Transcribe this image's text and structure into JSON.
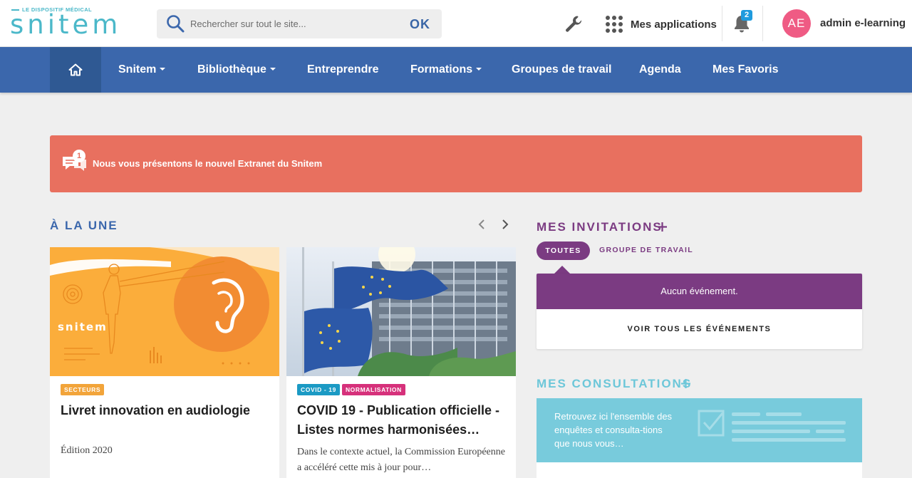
{
  "header": {
    "logo_tagline": "LE DISPOSITIF MÉDICAL",
    "logo_word": "snitem",
    "search_placeholder": "Rechercher sur tout le site...",
    "search_button": "OK",
    "apps_label": "Mes applications",
    "notifications_count": "2",
    "user_initials": "AE",
    "user_name": "admin e-learning"
  },
  "nav": {
    "items": [
      {
        "label": "Snitem",
        "dropdown": true
      },
      {
        "label": "Bibliothèque",
        "dropdown": true
      },
      {
        "label": "Entreprendre",
        "dropdown": false
      },
      {
        "label": "Formations",
        "dropdown": true
      },
      {
        "label": "Groupes de travail",
        "dropdown": false
      },
      {
        "label": "Agenda",
        "dropdown": false
      },
      {
        "label": "Mes Favoris",
        "dropdown": false
      }
    ]
  },
  "alert": {
    "count": "1",
    "text": "Nous vous présentons le nouvel Extranet du Snitem"
  },
  "une": {
    "title": "À LA UNE",
    "cards": [
      {
        "tags": [
          {
            "label": "SECTEURS",
            "color": "#f2a43a"
          }
        ],
        "image_label": "snitem",
        "title": "Livret innovation en audiologie",
        "meta": "Édition 2020"
      },
      {
        "tags": [
          {
            "label": "COVID - 19",
            "color": "#1b9ac4"
          },
          {
            "label": "NORMALISATION",
            "color": "#d6317b"
          }
        ],
        "title": "COVID 19 - Publication officielle - Listes normes harmonisées…",
        "text": "Dans le contexte actuel, la Commission Européenne a accéléré cette mis à jour pour…"
      }
    ]
  },
  "invitations": {
    "title": "MES INVITATIONS",
    "filter_all": "TOUTES",
    "filter_group": "GROUPE DE TRAVAIL",
    "empty_text": "Aucun événement.",
    "see_all": "VOIR TOUS LES ÉVÉNEMENTS"
  },
  "consultations": {
    "title": "MES CONSULTATIONS",
    "text": "Retrouvez ici l'ensemble des enquêtes et consulta-tions que nous vous…"
  },
  "colors": {
    "brand_blue": "#3b67ac",
    "brand_teal": "#4bb8c9",
    "alert": "#e8705f",
    "purple": "#7b3b82",
    "cyan": "#78cbdc"
  }
}
